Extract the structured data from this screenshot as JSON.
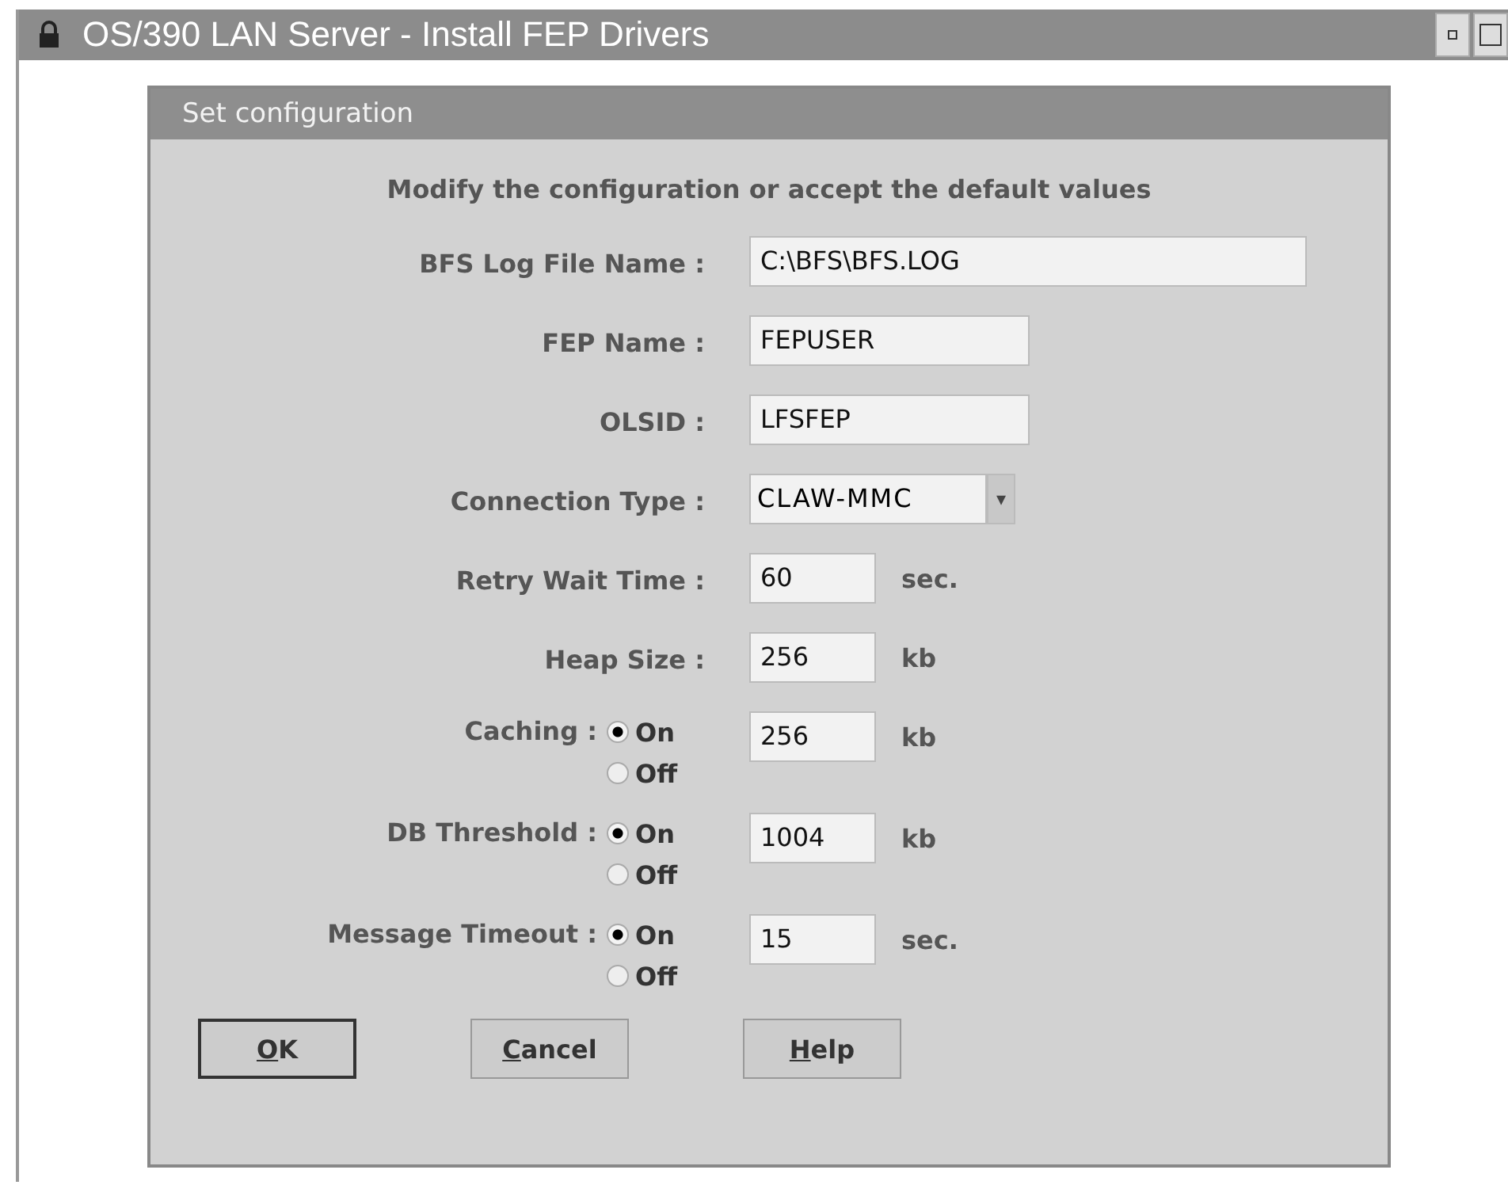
{
  "window": {
    "title": "OS/390 LAN Server - Install FEP Drivers"
  },
  "dialog": {
    "title": "Set configuration",
    "instruction": "Modify the configuration or accept the default values",
    "fields": [
      {
        "kind": "path",
        "label": "BFS Log File Name :",
        "value": "C:\\BFS\\BFS.LOG"
      },
      {
        "kind": "text",
        "label": "FEP Name :",
        "value": "FEPUSER"
      },
      {
        "kind": "text",
        "label": "OLSID :",
        "value": "LFSFEP"
      },
      {
        "kind": "combo",
        "label": "Connection Type :",
        "value": "CLAW-MMC",
        "button": "▾"
      },
      {
        "kind": "number",
        "label": "Retry Wait Time :",
        "value": "60",
        "unit": "sec."
      },
      {
        "kind": "number",
        "label": "Heap Size :",
        "value": "256",
        "unit": "kb"
      },
      {
        "kind": "toggle",
        "label": "Caching :",
        "options": [
          {
            "label": "On",
            "selected": true
          },
          {
            "label": "Off",
            "selected": false
          }
        ],
        "value": "256",
        "unit": "kb"
      },
      {
        "kind": "toggle",
        "label": "DB Threshold :",
        "options": [
          {
            "label": "On",
            "selected": true
          },
          {
            "label": "Off",
            "selected": false
          }
        ],
        "value": "1004",
        "unit": "kb"
      },
      {
        "kind": "toggle",
        "label": "Message Timeout :",
        "options": [
          {
            "label": "On",
            "selected": true
          },
          {
            "label": "Off",
            "selected": false
          }
        ],
        "value": "15",
        "unit": "sec."
      }
    ],
    "buttons": [
      {
        "label": "OK",
        "default": true
      },
      {
        "label": "Cancel",
        "default": false
      },
      {
        "label": "Help",
        "default": false
      }
    ]
  }
}
